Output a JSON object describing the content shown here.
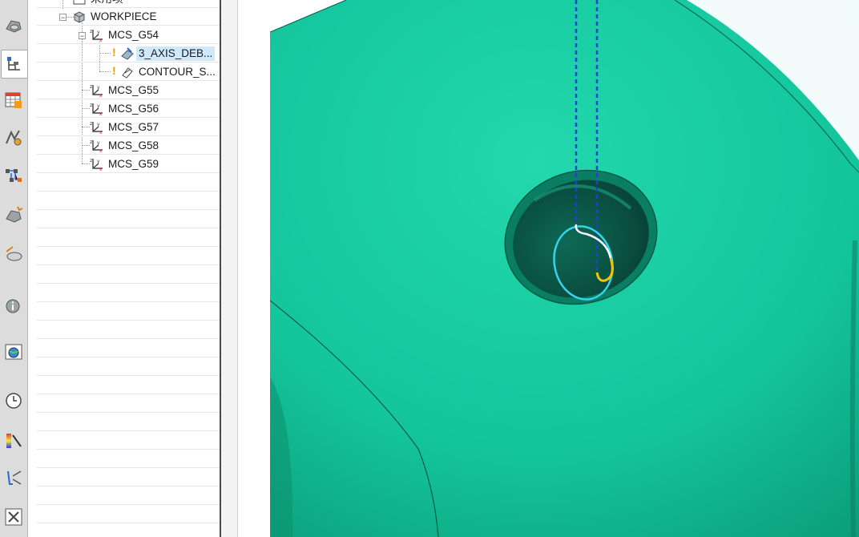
{
  "navigator": {
    "items": [
      {
        "label": "未用项",
        "icon": "geometry-icon"
      },
      {
        "label": "WORKPIECE",
        "icon": "workpiece-icon"
      },
      {
        "label": "MCS_G54",
        "icon": "mcs-icon"
      },
      {
        "label": "3_AXIS_DEB...",
        "icon": "operation-icon",
        "selected": true
      },
      {
        "label": "CONTOUR_S...",
        "icon": "operation-icon"
      },
      {
        "label": "MCS_G55",
        "icon": "mcs-icon"
      },
      {
        "label": "MCS_G56",
        "icon": "mcs-icon"
      },
      {
        "label": "MCS_G57",
        "icon": "mcs-icon"
      },
      {
        "label": "MCS_G58",
        "icon": "mcs-icon"
      },
      {
        "label": "MCS_G59",
        "icon": "mcs-icon"
      }
    ]
  },
  "toolbar": {
    "buttons": [
      "part-icon",
      "operation-navigator-icon",
      "machine-tool-icon",
      "tool-path-icon",
      "program-order-icon",
      "feature-icon",
      "cutting-icon",
      "info-icon",
      "browser-icon",
      "history-icon",
      "palette-icon",
      "tool-icon",
      "utilities-icon"
    ]
  },
  "colors": {
    "part": "#17c9a0",
    "toolpath_dashed": "#1f3fd9",
    "toolpath_cyan": "#36d3ec",
    "toolpath_yellow": "#f5c400"
  }
}
